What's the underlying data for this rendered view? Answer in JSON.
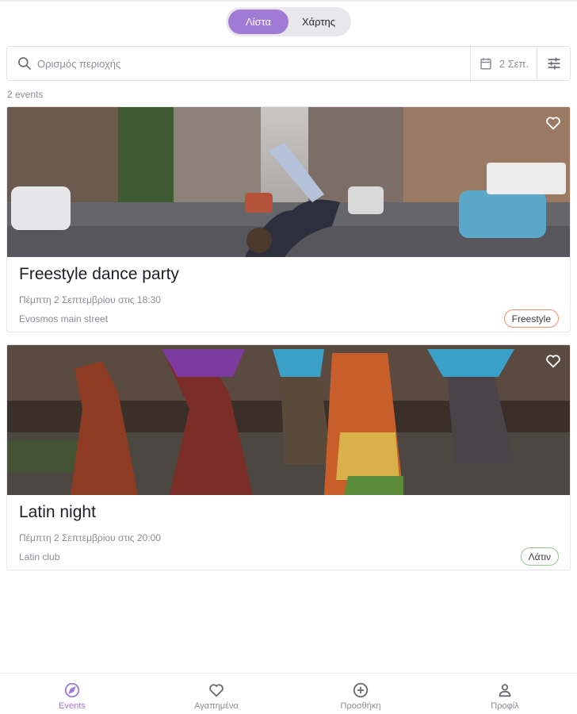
{
  "view_toggle": {
    "list_label": "Λίστα",
    "map_label": "Χάρτης",
    "active": "list"
  },
  "search": {
    "placeholder": "Ορισμός περιοχής",
    "value": "",
    "icon": "search-icon"
  },
  "date_filter": {
    "label": "2 Σεπ.",
    "icon": "calendar-icon"
  },
  "filters_icon": "sliders-icon",
  "events_count": "2 events",
  "events": [
    {
      "title": "Freestyle dance party",
      "date": "Πέμπτη 2 Σεπτεμβρίου στις 18:30",
      "venue": "Evosmos main street",
      "tag": "Freestyle",
      "tag_color": "#ea8f74",
      "favorite": false
    },
    {
      "title": "Latin night",
      "date": "Πέμπτη 2 Σεπτεμβρίου στις 20:00",
      "venue": "Latin club",
      "tag": "Λάτιν",
      "tag_color": "#97c78e",
      "favorite": false
    }
  ],
  "bottom_nav": [
    {
      "label": "Events",
      "icon": "compass-icon",
      "active": true
    },
    {
      "label": "Αγαπημένα",
      "icon": "heart-icon",
      "active": false
    },
    {
      "label": "Προσθήκη",
      "icon": "add-circle-icon",
      "active": false
    },
    {
      "label": "Προφίλ",
      "icon": "person-icon",
      "active": false
    }
  ],
  "colors": {
    "accent": "#a17ad6",
    "muted_text": "#8b8b94",
    "border": "#e4e4ea"
  }
}
